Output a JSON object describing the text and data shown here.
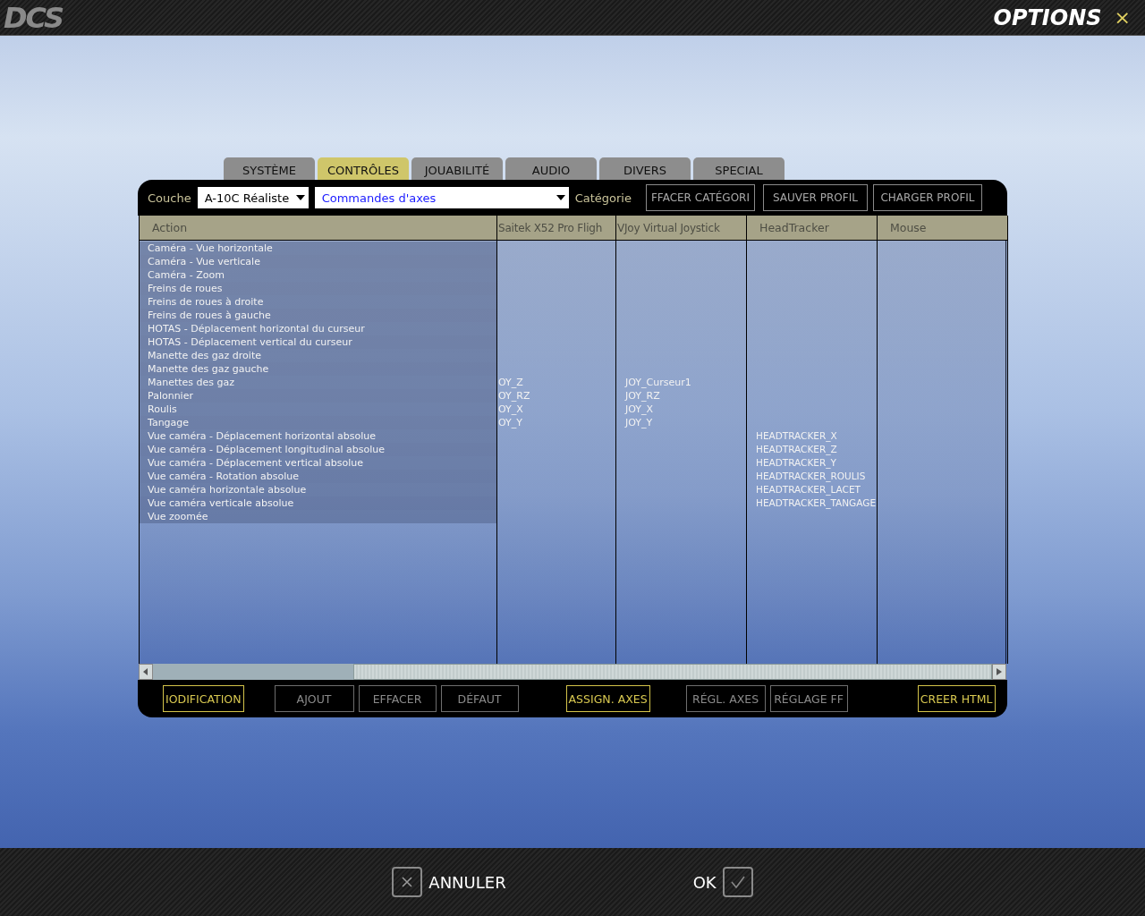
{
  "header": {
    "logo": "DCS",
    "title": "OPTIONS",
    "close": "×"
  },
  "tabs": [
    {
      "label": "SYSTÈME",
      "selected": false
    },
    {
      "label": "CONTRÔLES",
      "selected": true
    },
    {
      "label": "JOUABILITÉ",
      "selected": false
    },
    {
      "label": "AUDIO",
      "selected": false
    },
    {
      "label": "DIVERS",
      "selected": false
    },
    {
      "label": "SPECIAL",
      "selected": false
    }
  ],
  "toolbar": {
    "layer_label": "Couche",
    "layer_value": "A-10C Réaliste",
    "category_value": "Commandes d'axes",
    "category_label": "Catégorie",
    "buttons": [
      "FFACER CATÉGORI",
      "SAUVER PROFIL",
      "CHARGER PROFIL"
    ]
  },
  "table": {
    "columns": [
      "Action",
      "Saitek X52 Pro Fligh",
      "VJoy Virtual Joystick",
      "HeadTracker",
      "Mouse"
    ],
    "rows": [
      {
        "action": "Caméra - Vue horizontale"
      },
      {
        "action": "Caméra - Vue verticale"
      },
      {
        "action": "Caméra - Zoom"
      },
      {
        "action": "Freins de roues"
      },
      {
        "action": "Freins de roues à droite"
      },
      {
        "action": "Freins de roues à gauche"
      },
      {
        "action": "HOTAS - Déplacement horizontal du curseur"
      },
      {
        "action": "HOTAS - Déplacement vertical du curseur"
      },
      {
        "action": "Manette des gaz droite"
      },
      {
        "action": "Manette des gaz gauche"
      },
      {
        "action": "Manettes des gaz",
        "saitek": "OY_Z",
        "vjoy": "JOY_Curseur1"
      },
      {
        "action": "Palonnier",
        "saitek": "OY_RZ",
        "vjoy": "JOY_RZ"
      },
      {
        "action": "Roulis",
        "saitek": "OY_X",
        "vjoy": "JOY_X"
      },
      {
        "action": "Tangage",
        "saitek": "OY_Y",
        "vjoy": "JOY_Y"
      },
      {
        "action": "Vue caméra - Déplacement horizontal absolue",
        "headtracker": "HEADTRACKER_X"
      },
      {
        "action": "Vue caméra - Déplacement longitudinal absolue",
        "headtracker": "HEADTRACKER_Z"
      },
      {
        "action": "Vue caméra - Déplacement vertical absolue",
        "headtracker": "HEADTRACKER_Y"
      },
      {
        "action": "Vue caméra - Rotation absolue",
        "headtracker": "HEADTRACKER_ROULIS"
      },
      {
        "action": "Vue caméra horizontale absolue",
        "headtracker": "HEADTRACKER_LACET"
      },
      {
        "action": "Vue caméra verticale absolue",
        "headtracker": "HEADTRACKER_TANGAGE"
      },
      {
        "action": "Vue zoomée"
      }
    ]
  },
  "actions": [
    {
      "label": "IODIFICATION",
      "disabled": false
    },
    {
      "label": "AJOUT",
      "disabled": true
    },
    {
      "label": "EFFACER",
      "disabled": true
    },
    {
      "label": "DÉFAUT",
      "disabled": true
    },
    {
      "label": "ASSIGN. AXES",
      "disabled": false
    },
    {
      "label": "RÉGL. AXES",
      "disabled": true
    },
    {
      "label": "RÉGLAGE FF",
      "disabled": true
    },
    {
      "label": "CREER HTML",
      "disabled": false
    }
  ],
  "footer": {
    "cancel": "ANNULER",
    "ok": "OK"
  }
}
